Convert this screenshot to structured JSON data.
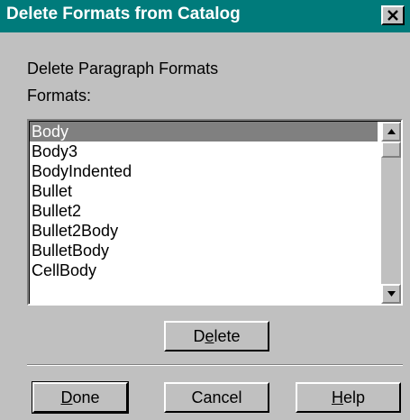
{
  "window": {
    "title": "Delete Formats from Catalog",
    "close_icon": "close-icon"
  },
  "section": {
    "heading": "Delete Paragraph Formats",
    "list_label": "Formats:"
  },
  "formats_list": {
    "selected_index": 0,
    "items": [
      "Body",
      "Body3",
      "BodyIndented",
      "Bullet",
      "Bullet2",
      "Bullet2Body",
      "BulletBody",
      "CellBody"
    ]
  },
  "buttons": {
    "delete": {
      "before": "D",
      "mnemonic": "e",
      "after": "lete"
    },
    "done": {
      "before": "",
      "mnemonic": "D",
      "after": "one"
    },
    "cancel": {
      "label": "Cancel"
    },
    "help": {
      "before": "",
      "mnemonic": "H",
      "after": "elp"
    }
  },
  "colors": {
    "title_bar": "#007b7b",
    "dialog_face": "#c0c0c0",
    "selection": "#808080"
  }
}
